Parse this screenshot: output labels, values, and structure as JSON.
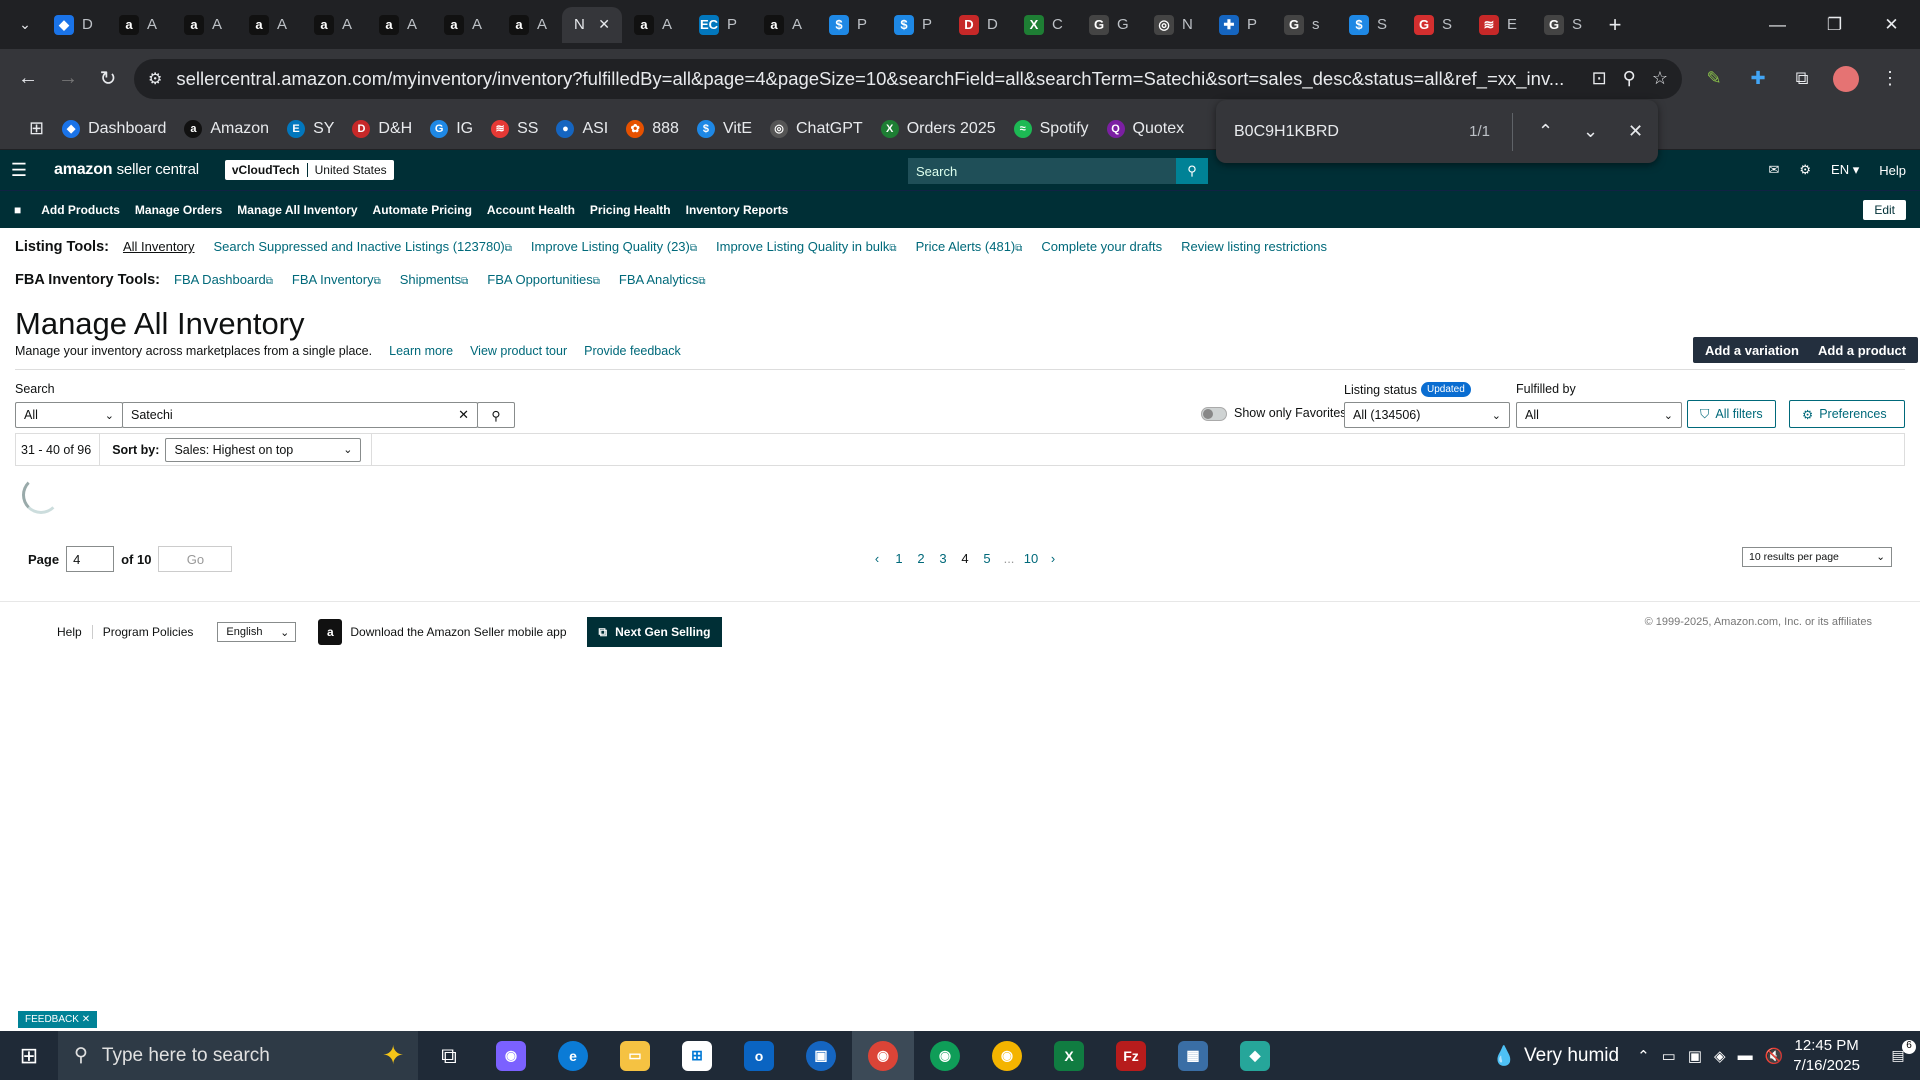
{
  "browser": {
    "tabs": [
      {
        "label": "D",
        "color": "#1a73e8",
        "glyph": "◆"
      },
      {
        "label": "A",
        "color": "#111",
        "glyph": "a"
      },
      {
        "label": "A",
        "color": "#111",
        "glyph": "a"
      },
      {
        "label": "A",
        "color": "#111",
        "glyph": "a"
      },
      {
        "label": "A",
        "color": "#111",
        "glyph": "a"
      },
      {
        "label": "A",
        "color": "#111",
        "glyph": "a"
      },
      {
        "label": "A",
        "color": "#111",
        "glyph": "a"
      },
      {
        "label": "A",
        "color": "#111",
        "glyph": "a"
      },
      {
        "label": "N",
        "color": "#35363a",
        "glyph": "",
        "active": true
      },
      {
        "label": "A",
        "color": "#111",
        "glyph": "a"
      },
      {
        "label": "P",
        "color": "#0277bd",
        "glyph": "EC"
      },
      {
        "label": "A",
        "color": "#111",
        "glyph": "a"
      },
      {
        "label": "P",
        "color": "#1e88e5",
        "glyph": "$"
      },
      {
        "label": "P",
        "color": "#1e88e5",
        "glyph": "$"
      },
      {
        "label": "D",
        "color": "#c62828",
        "glyph": "D"
      },
      {
        "label": "C",
        "color": "#1e7e34",
        "glyph": "X"
      },
      {
        "label": "G",
        "color": "#444",
        "glyph": "G"
      },
      {
        "label": "N",
        "color": "#444",
        "glyph": "◎"
      },
      {
        "label": "P",
        "color": "#1565c0",
        "glyph": "✚"
      },
      {
        "label": "s",
        "color": "#444",
        "glyph": "G"
      },
      {
        "label": "S",
        "color": "#1e88e5",
        "glyph": "$"
      },
      {
        "label": "S",
        "color": "#d32f2f",
        "glyph": "G"
      },
      {
        "label": "E",
        "color": "#c62828",
        "glyph": "≋"
      },
      {
        "label": "S",
        "color": "#444",
        "glyph": "G"
      }
    ],
    "url": "sellercentral.amazon.com/myinventory/inventory?fulfilledBy=all&page=4&pageSize=10&searchField=all&searchTerm=Satechi&sort=sales_desc&status=all&ref_=xx_inv...",
    "bookmarks": [
      {
        "label": "Dashboard",
        "color": "#1a73e8",
        "glyph": "◆"
      },
      {
        "label": "Amazon",
        "color": "#111",
        "glyph": "a"
      },
      {
        "label": "SY",
        "color": "#0277bd",
        "glyph": "E"
      },
      {
        "label": "D&H",
        "color": "#c62828",
        "glyph": "D"
      },
      {
        "label": "IG",
        "color": "#1e88e5",
        "glyph": "G"
      },
      {
        "label": "SS",
        "color": "#e53935",
        "glyph": "≋"
      },
      {
        "label": "ASI",
        "color": "#1565c0",
        "glyph": "●"
      },
      {
        "label": "888",
        "color": "#e65100",
        "glyph": "✿"
      },
      {
        "label": "VitE",
        "color": "#1e88e5",
        "glyph": "$"
      },
      {
        "label": "ChatGPT",
        "color": "#555",
        "glyph": "◎"
      },
      {
        "label": "Orders 2025",
        "color": "#1e7e34",
        "glyph": "X"
      },
      {
        "label": "Spotify",
        "color": "#1db954",
        "glyph": "≈"
      },
      {
        "label": "Quotex",
        "color": "#7b1fa2",
        "glyph": "Q"
      }
    ],
    "find": {
      "query": "B0C9H1KBRD",
      "count": "1/1"
    }
  },
  "sc": {
    "logo": "amazon",
    "logo_suffix": "seller central",
    "account": "vCloudTech",
    "region": "United States",
    "search_placeholder": "Search",
    "lang": "EN",
    "help": "Help",
    "nav": [
      "Add Products",
      "Manage Orders",
      "Manage All Inventory",
      "Automate Pricing",
      "Account Health",
      "Pricing Health",
      "Inventory Reports"
    ],
    "edit": "Edit"
  },
  "listing_tools": {
    "label": "Listing Tools:",
    "links": [
      "All Inventory",
      "Search Suppressed and Inactive Listings (123780)",
      "Improve Listing Quality (23)",
      "Improve Listing Quality in bulk",
      "Price Alerts (481)",
      "Complete your drafts",
      "Review listing restrictions"
    ]
  },
  "fba_tools": {
    "label": "FBA Inventory Tools:",
    "links": [
      "FBA Dashboard",
      "FBA Inventory",
      "Shipments",
      "FBA Opportunities",
      "FBA Analytics"
    ]
  },
  "page": {
    "title": "Manage All Inventory",
    "subtitle": "Manage your inventory across marketplaces from a single place.",
    "learn_more": "Learn more",
    "tour": "View product tour",
    "feedback_link": "Provide feedback",
    "add_variation": "Add a variation",
    "add_product": "Add a product"
  },
  "filters": {
    "search_label": "Search",
    "search_field": "All",
    "search_value": "Satechi",
    "favorites": "Show only Favorites",
    "listing_status_label": "Listing status",
    "listing_status_badge": "Updated",
    "listing_status_value": "All (134506)",
    "fulfilled_label": "Fulfilled by",
    "fulfilled_value": "All",
    "all_filters": "All filters",
    "preferences": "Preferences"
  },
  "results": {
    "range": "31 - 40 of 96",
    "sort_label": "Sort by:",
    "sort_value": "Sales: Highest on top"
  },
  "pagination": {
    "page_label": "Page",
    "page_value": "4",
    "of": "of 10",
    "go": "Go",
    "pages": [
      "1",
      "2",
      "3",
      "4",
      "5",
      "...",
      "10"
    ],
    "current": "4",
    "per_page": "10 results per page"
  },
  "footer": {
    "help": "Help",
    "policies": "Program Policies",
    "language": "English",
    "app": "Download the Amazon Seller mobile app",
    "ngs": "Next Gen Selling",
    "copyright": "© 1999-2025, Amazon.com, Inc. or its affiliates",
    "feedback": "FEEDBACK"
  },
  "taskbar": {
    "search_placeholder": "Type here to search",
    "weather": "Very humid",
    "time": "12:45 PM",
    "date": "7/16/2025",
    "notifications": "6"
  }
}
